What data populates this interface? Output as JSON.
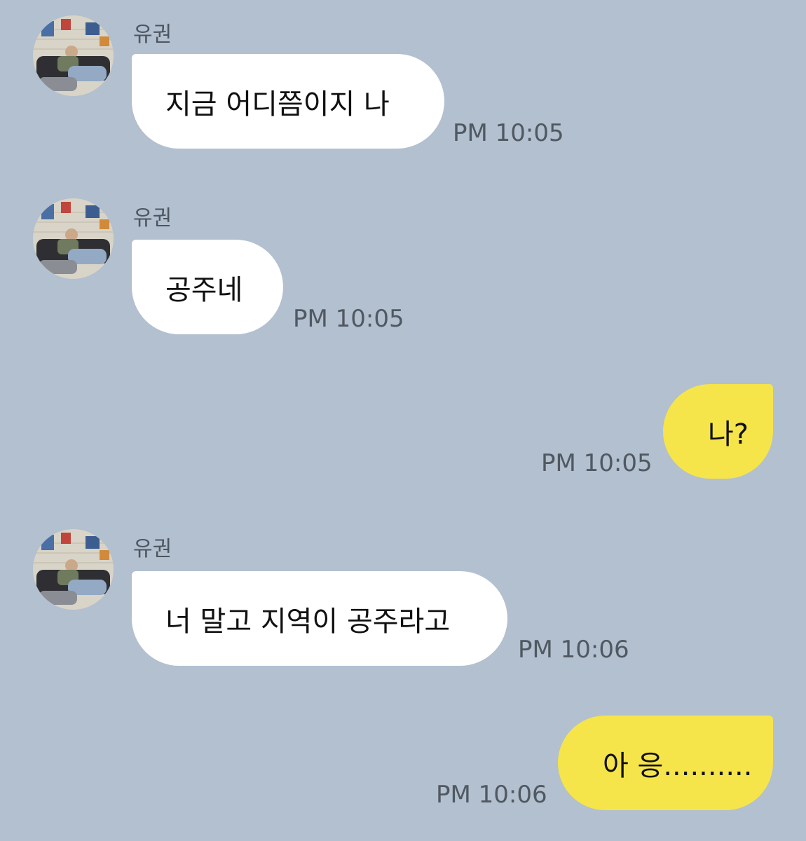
{
  "chat": {
    "messages": [
      {
        "direction": "incoming",
        "sender": "유권",
        "text": "지금 어디쯤이지 나",
        "time": "PM 10:05"
      },
      {
        "direction": "incoming",
        "sender": "유권",
        "text": "공주네",
        "time": "PM 10:05"
      },
      {
        "direction": "outgoing",
        "text": "나?",
        "time": "PM 10:05"
      },
      {
        "direction": "incoming",
        "sender": "유권",
        "text": "너 말고 지역이 공주라고",
        "time": "PM 10:06"
      },
      {
        "direction": "outgoing",
        "text": "아 응..........",
        "time": "PM 10:06"
      }
    ]
  },
  "colors": {
    "background": "#b2c0cf",
    "incoming_bubble": "#ffffff",
    "outgoing_bubble": "#f6e44b"
  },
  "icons": {
    "avatar": "profile-photo-icon"
  }
}
